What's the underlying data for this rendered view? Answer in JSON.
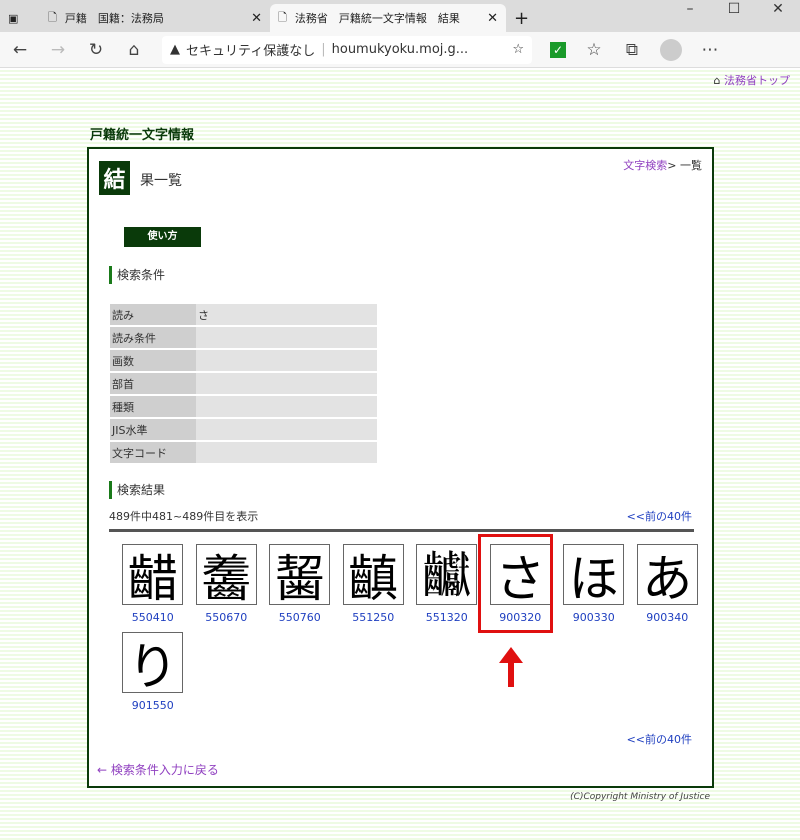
{
  "browser": {
    "tabs": [
      {
        "title": "戸籍　国籍：法務局",
        "active": false
      },
      {
        "title": "法務省　戸籍統一文字情報　結果",
        "active": true
      }
    ],
    "address": {
      "security": "セキュリティ保護なし",
      "url": "houmukyoku.moj.g..."
    }
  },
  "page": {
    "top_link": "法務省トップ",
    "site_title": "戸籍統一文字情報",
    "heading_char": "結",
    "heading_rest": "果一覧",
    "breadcrumb": {
      "link": "文字検索",
      "sep": ">",
      "current": " 一覧"
    },
    "howto_button": "使い方",
    "conditions_heading": "検索条件",
    "conditions": [
      {
        "label": "読み",
        "value": "さ"
      },
      {
        "label": "読み条件",
        "value": ""
      },
      {
        "label": "画数",
        "value": ""
      },
      {
        "label": "部首",
        "value": ""
      },
      {
        "label": "種類",
        "value": ""
      },
      {
        "label": "JIS水準",
        "value": ""
      },
      {
        "label": "文字コード",
        "value": ""
      }
    ],
    "results_heading": "検索結果",
    "count_text": "489件中481~489件目を表示",
    "prev_link": "<<前の40件",
    "results": [
      {
        "glyph": "齰",
        "code": "550410"
      },
      {
        "glyph": "齹",
        "code": "550670"
      },
      {
        "glyph": "𪘂",
        "code": "550760"
      },
      {
        "glyph": "齻",
        "code": "551250"
      },
      {
        "glyph": "𪚋",
        "code": "551320"
      },
      {
        "glyph": "さ",
        "code": "900320",
        "highlighted": true
      },
      {
        "glyph": "ほ",
        "code": "900330"
      },
      {
        "glyph": "あ",
        "code": "900340"
      },
      {
        "glyph": "り",
        "code": "901550"
      }
    ],
    "back_link": "← 検索条件入力に戻る",
    "copyright": "(C)Copyright Ministry of Justice",
    "colors": {
      "brand": "#0a3a0a",
      "highlight": "#e01010",
      "link": "#2040c0",
      "visited": "#9040c0"
    }
  }
}
